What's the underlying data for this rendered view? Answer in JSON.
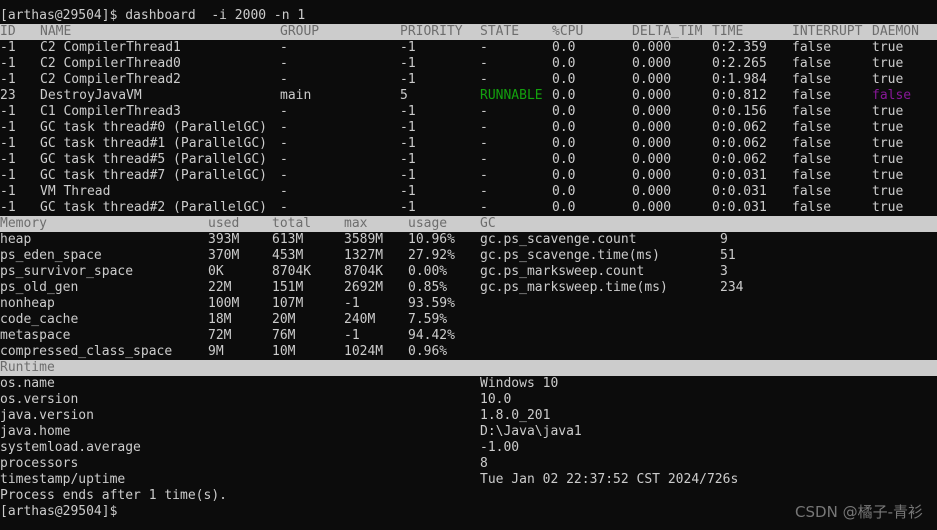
{
  "prompt_top": "[arthas@29504]$ dashboard  -i 2000 -n 1",
  "threads": {
    "headers": [
      "ID",
      "NAME",
      "GROUP",
      "PRIORITY",
      "STATE",
      "%CPU",
      "DELTA_TIM",
      "TIME",
      "INTERRUPT",
      "DAEMON"
    ],
    "rows": [
      [
        "-1",
        "C2 CompilerThread1",
        "-",
        "-1",
        "-",
        "0.0",
        "0.000",
        "0:2.359",
        "false",
        "true"
      ],
      [
        "-1",
        "C2 CompilerThread0",
        "-",
        "-1",
        "-",
        "0.0",
        "0.000",
        "0:2.265",
        "false",
        "true"
      ],
      [
        "-1",
        "C2 CompilerThread2",
        "-",
        "-1",
        "-",
        "0.0",
        "0.000",
        "0:1.984",
        "false",
        "true"
      ],
      [
        "23",
        "DestroyJavaVM",
        "main",
        "5",
        "RUNNABLE",
        "0.0",
        "0.000",
        "0:0.812",
        "false",
        "false"
      ],
      [
        "-1",
        "C1 CompilerThread3",
        "-",
        "-1",
        "-",
        "0.0",
        "0.000",
        "0:0.156",
        "false",
        "true"
      ],
      [
        "-1",
        "GC task thread#0 (ParallelGC)",
        "-",
        "-1",
        "-",
        "0.0",
        "0.000",
        "0:0.062",
        "false",
        "true"
      ],
      [
        "-1",
        "GC task thread#1 (ParallelGC)",
        "-",
        "-1",
        "-",
        "0.0",
        "0.000",
        "0:0.062",
        "false",
        "true"
      ],
      [
        "-1",
        "GC task thread#5 (ParallelGC)",
        "-",
        "-1",
        "-",
        "0.0",
        "0.000",
        "0:0.062",
        "false",
        "true"
      ],
      [
        "-1",
        "GC task thread#7 (ParallelGC)",
        "-",
        "-1",
        "-",
        "0.0",
        "0.000",
        "0:0.031",
        "false",
        "true"
      ],
      [
        "-1",
        "VM Thread",
        "-",
        "-1",
        "-",
        "0.0",
        "0.000",
        "0:0.031",
        "false",
        "true"
      ],
      [
        "-1",
        "GC task thread#2 (ParallelGC)",
        "-",
        "-1",
        "-",
        "0.0",
        "0.000",
        "0:0.031",
        "false",
        "true"
      ]
    ]
  },
  "memory": {
    "headers": [
      "Memory",
      "used",
      "total",
      "max",
      "usage",
      "GC"
    ],
    "rows": [
      [
        "heap",
        "393M",
        "613M",
        "3589M",
        "10.96%"
      ],
      [
        "ps_eden_space",
        "370M",
        "453M",
        "1327M",
        "27.92%"
      ],
      [
        "ps_survivor_space",
        "0K",
        "8704K",
        "8704K",
        "0.00%"
      ],
      [
        "ps_old_gen",
        "22M",
        "151M",
        "2692M",
        "0.85%"
      ],
      [
        "nonheap",
        "100M",
        "107M",
        "-1",
        "93.59%"
      ],
      [
        "code_cache",
        "18M",
        "20M",
        "240M",
        "7.59%"
      ],
      [
        "metaspace",
        "72M",
        "76M",
        "-1",
        "94.42%"
      ],
      [
        "compressed_class_space",
        "9M",
        "10M",
        "1024M",
        "0.96%"
      ]
    ],
    "gc": [
      [
        "gc.ps_scavenge.count",
        "9"
      ],
      [
        "gc.ps_scavenge.time(ms)",
        "51"
      ],
      [
        "gc.ps_marksweep.count",
        "3"
      ],
      [
        "gc.ps_marksweep.time(ms)",
        "234"
      ]
    ]
  },
  "runtime": {
    "header": "Runtime",
    "rows": [
      [
        "os.name",
        "Windows 10"
      ],
      [
        "os.version",
        "10.0"
      ],
      [
        "java.version",
        "1.8.0_201"
      ],
      [
        "java.home",
        "D:\\Java\\java1"
      ],
      [
        "systemload.average",
        "-1.00"
      ],
      [
        "processors",
        "8"
      ],
      [
        "timestamp/uptime",
        "Tue Jan 02 22:37:52 CST 2024/726s"
      ]
    ]
  },
  "footer": "Process ends after 1 time(s).",
  "prompt_bottom": "[arthas@29504]$",
  "watermark": "CSDN @橘子-青衫",
  "colors": {
    "background": "#0c0c0c",
    "text": "#cccccc",
    "band": "#cccccc",
    "runnable": "#13a10e",
    "daemon_false": "#881798"
  }
}
